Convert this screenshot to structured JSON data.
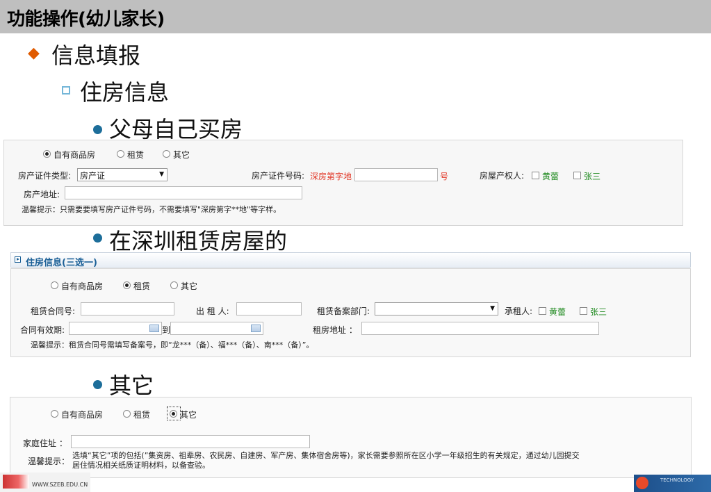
{
  "slide": {
    "title": "功能操作(幼儿家长)",
    "level1": "信息填报",
    "level2": "住房信息",
    "bullet_buy": "父母自己买房",
    "bullet_rent": "在深圳租赁房屋的",
    "bullet_other": "其它"
  },
  "housing_options": [
    "自有商品房",
    "租赁",
    "其它"
  ],
  "panel_buy": {
    "cert_type_label": "房产证件类型:",
    "cert_type_value": "房产证",
    "cert_no_label": "房产证件号码:",
    "cert_no_prefix": "深房第字地",
    "cert_no_suffix": "号",
    "owner_label": "房屋产权人:",
    "owner_1": "黄蕾",
    "owner_2": "张三",
    "address_label": "房产地址:",
    "tip": "温馨提示：只需要要填写房产证件号码，不需要填写\"深房第字**地\"等字样。"
  },
  "panel_rent": {
    "section_title": "住房信息(三选一)",
    "contract_no_label": "租赁合同号:",
    "lessor_label": "出 租 人:",
    "filing_dept_label": "租赁备案部门:",
    "tenant_label": "承租人:",
    "tenant_1": "黄蕾",
    "tenant_2": "张三",
    "valid_label": "合同有效期:",
    "to_label": "到",
    "rent_address_label": "租房地址 ：",
    "tip": "温馨提示：租赁合同号需填写备案号，即“龙***（备）、福***（备）、南***（备）”。"
  },
  "panel_other": {
    "home_address_label": "家庭住址 ：",
    "tip_label": "温馨提示：",
    "tip_line1": "选填“其它”项的包括(”集资房、祖辈房、农民房、自建房、军产房、集体宿舍房等)，家长需要参照所在区小学一年级招生的有关规定，通过幼儿园提交",
    "tip_line2": "居住情况相关纸质证明材料，以备查验。"
  },
  "footer": {
    "left_url": "WWW.SZEB.EDU.CN",
    "right_text": "TECHNOLOGY"
  }
}
